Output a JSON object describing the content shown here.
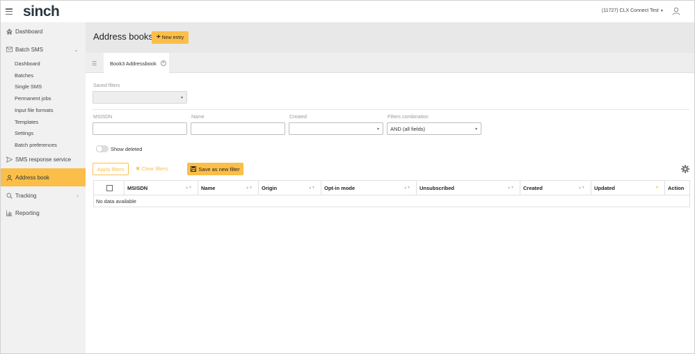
{
  "header": {
    "logo": "sinch",
    "account": "(11727) CLX Connect Test"
  },
  "sidebar": {
    "dashboard": "Dashboard",
    "batch_sms": "Batch SMS",
    "batch_sub": [
      "Dashboard",
      "Batches",
      "Single SMS",
      "Permanent jobs",
      "Input file formats",
      "Templates",
      "Settings",
      "Batch preferences"
    ],
    "sms_response": "SMS response service",
    "address_book": "Address book",
    "tracking": "Tracking",
    "reporting": "Reporting"
  },
  "page": {
    "title": "Address books",
    "new_entry": "New entry",
    "tab": "Book3 Addressbook"
  },
  "filters": {
    "saved_filters_label": "Saved filters",
    "msisdn_label": "MSISDN",
    "name_label": "Name",
    "created_label": "Created",
    "combination_label": "Filters combination",
    "combination_value": "AND (all fields)",
    "show_deleted": "Show deleted",
    "apply": "Apply filters",
    "clear": "Clear filters",
    "save": "Save as new filter"
  },
  "table": {
    "columns": [
      "MSISDN",
      "Name",
      "Origin",
      "Opt-in mode",
      "Unsubscribed",
      "Created",
      "Updated",
      "Action"
    ],
    "empty": "No data available"
  },
  "colors": {
    "accent": "#fbbe48",
    "sidebar": "#f1f1f1"
  }
}
